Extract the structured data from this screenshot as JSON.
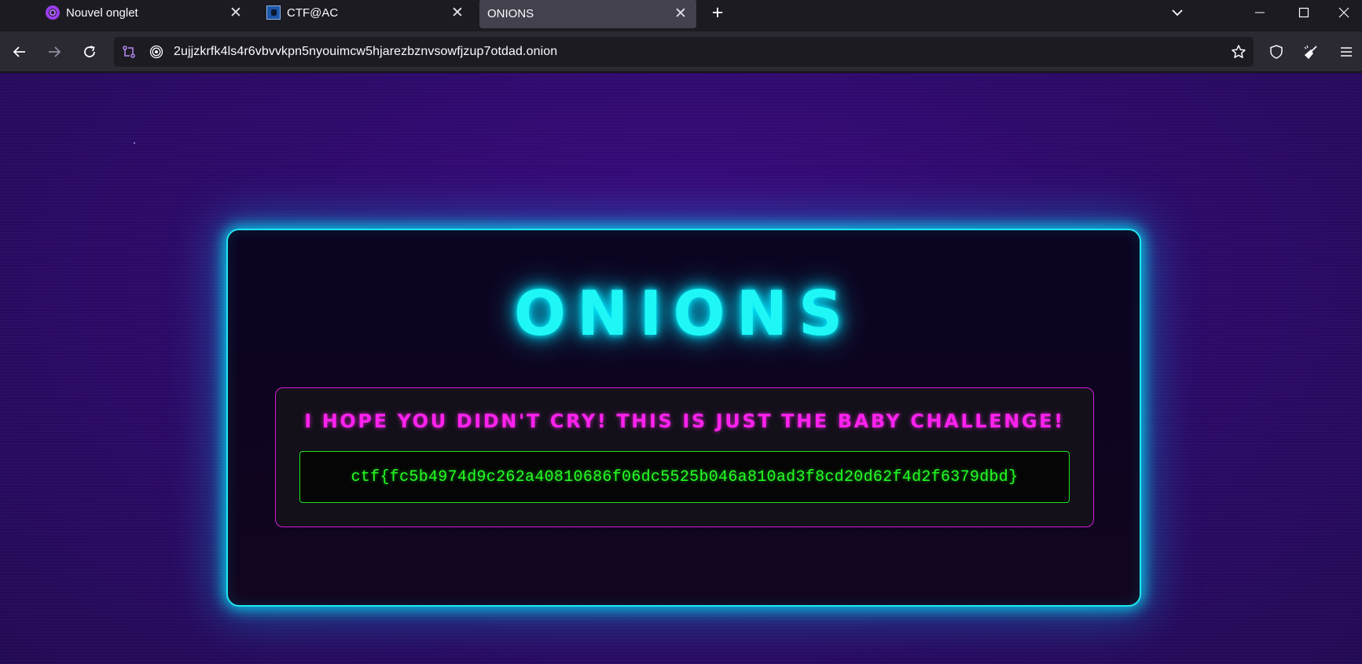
{
  "browser": {
    "tabs": [
      {
        "title": "Nouvel onglet",
        "icon": "tor-onion-icon"
      },
      {
        "title": "CTF@AC",
        "icon": "ctf-favicon-icon"
      },
      {
        "title": "ONIONS",
        "active": true
      }
    ],
    "new_tab_label": "+",
    "address": "2ujjzkrfk4ls4r6vbvvkpn5nyouimcw5hjarezbznvsowfjzup7otdad.onion"
  },
  "page": {
    "title": "ONIONS",
    "message": "I HOPE YOU DIDN'T CRY! THIS IS JUST THE BABY CHALLENGE!",
    "flag": "ctf{fc5b4974d9c262a40810686f06dc5525b046a810ad3f8cd20d62f4d2f6379dbd}"
  },
  "colors": {
    "background": "#2e0a6b",
    "title_neon": "#1ff7f7",
    "message": "#ff22ee",
    "flag": "#22ff22",
    "card_border": "#1fe6f0"
  }
}
